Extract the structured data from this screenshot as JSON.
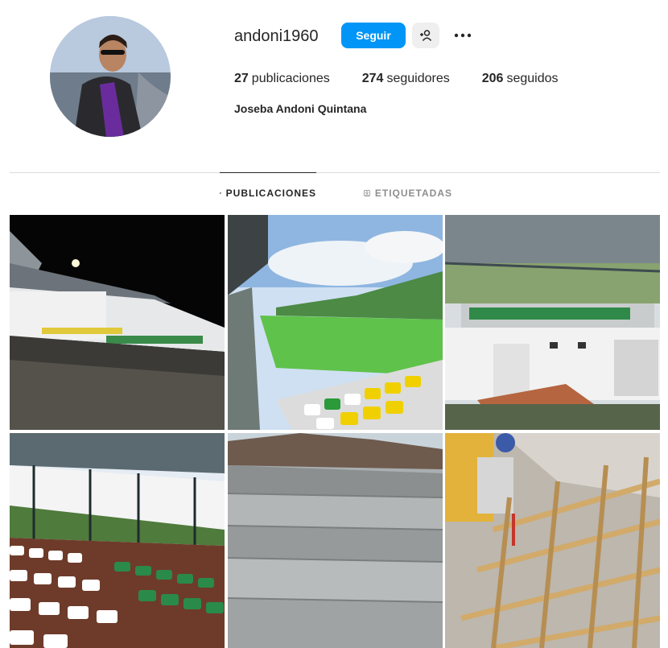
{
  "profile": {
    "username": "andoni1960",
    "full_name": "Joseba Andoni Quintana",
    "follow_label": "Seguir",
    "posts_count": "27",
    "posts_label": "publicaciones",
    "followers_count": "274",
    "followers_label": "seguidores",
    "following_count": "206",
    "following_label": "seguidos",
    "icons": {
      "suggest": "add-person-icon",
      "more": "more-options-icon"
    }
  },
  "tabs": [
    {
      "label": "PUBLICACIONES",
      "icon": "grid-icon",
      "active": true
    },
    {
      "label": "ETIQUETADAS",
      "icon": "tagged-icon",
      "active": false
    }
  ],
  "colors": {
    "primary_button": "#0095f6",
    "secondary_button": "#efefef",
    "text": "#262626",
    "muted": "#8e8e8e",
    "divider": "#dbdbdb"
  },
  "posts": [
    {
      "subject": "night stadium stands"
    },
    {
      "subject": "stadium field and green-yellow seats"
    },
    {
      "subject": "stadium stand under construction"
    },
    {
      "subject": "white and green stand seats"
    },
    {
      "subject": "concrete terraces"
    },
    {
      "subject": "worker on wooden formwork"
    }
  ]
}
